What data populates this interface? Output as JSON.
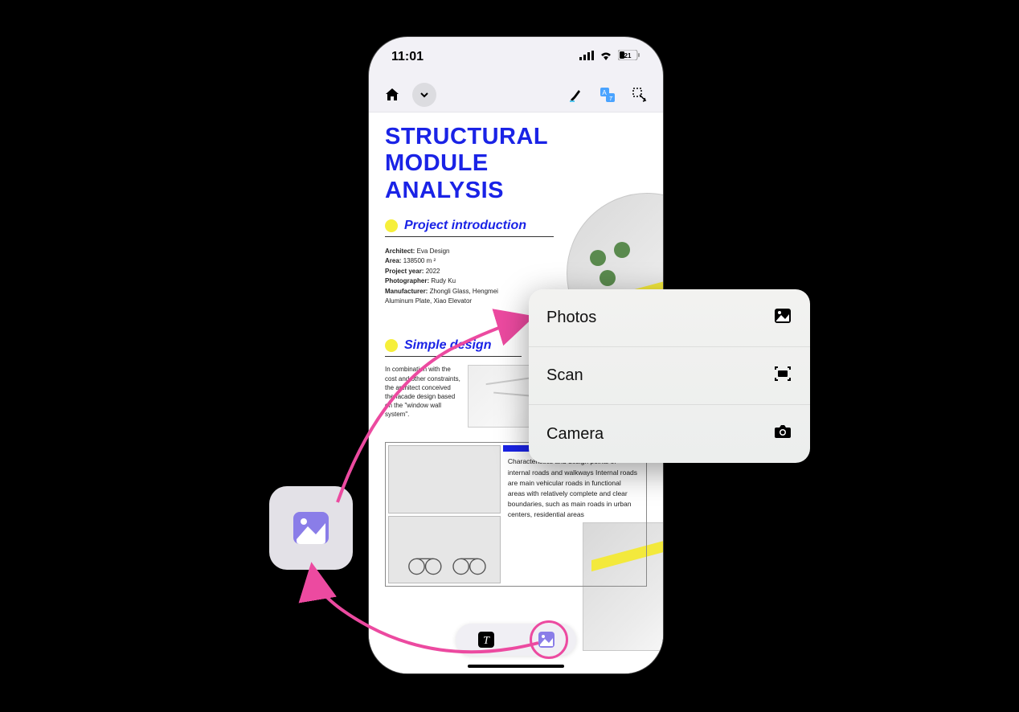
{
  "statusbar": {
    "time": "11:01",
    "battery_pct": "21"
  },
  "toolbar": {
    "home": "home",
    "chevron": "chevron-down",
    "highlighter": "highlighter",
    "translate": "translate",
    "insert": "insert"
  },
  "document": {
    "title": "STRUCTURAL MODULE ANALYSIS",
    "section1_title": "Project introduction",
    "meta": {
      "architect_label": "Architect:",
      "architect_value": "Eva Design",
      "area_label": "Area:",
      "area_value": "138500 m ²",
      "year_label": "Project year:",
      "year_value": "2022",
      "photographer_label": "Photographer:",
      "photographer_value": "Rudy Ku",
      "manufacturer_label": "Manufacturer:",
      "manufacturer_value": "Zhongli Glass, Hengmei Aluminum Plate, Xiao Elevator"
    },
    "section2_title": "Simple design",
    "section2_body": "In combination with the cost and other constraints, the architect conceived the facade design based on the \"window wall system\".",
    "grid_text": "Characteristics and design points of internal roads and walkways Internal roads are main vehicular roads in functional areas with relatively complete and clear boundaries, such as main roads in urban centers, residential areas"
  },
  "popup": {
    "items": [
      {
        "label": "Photos",
        "icon": "photo-icon"
      },
      {
        "label": "Scan",
        "icon": "scan-icon"
      },
      {
        "label": "Camera",
        "icon": "camera-icon"
      }
    ]
  },
  "bottombar": {
    "text_tool": "T",
    "image_tool": "image"
  },
  "colors": {
    "accent_blue": "#1a23e6",
    "bullet_yellow": "#f6ef3a",
    "annotation_pink": "#ec4aa0",
    "tile_purple": "#8a7de8"
  }
}
